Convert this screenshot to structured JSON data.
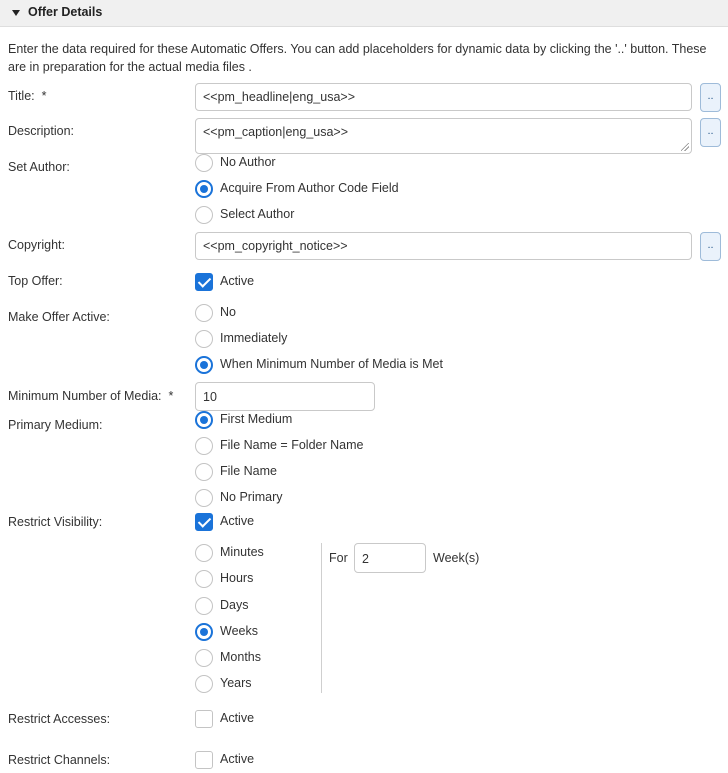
{
  "section": {
    "title": "Offer Details"
  },
  "intro": "Enter the data required for these Automatic Offers. You can add placeholders for dynamic data by clicking the '..' button. These are in preparation for the actual media files .",
  "dots_label": "..",
  "title_field": {
    "label": "Title:",
    "required": "*",
    "value": "<<pm_headline|eng_usa>>"
  },
  "description_field": {
    "label": "Description:",
    "value": "<<pm_caption|eng_usa>>"
  },
  "set_author": {
    "label": "Set Author:",
    "options": [
      "No Author",
      "Acquire From Author Code Field",
      "Select Author"
    ],
    "selected": "Acquire From Author Code Field"
  },
  "copyright_field": {
    "label": "Copyright:",
    "value": "<<pm_copyright_notice>>"
  },
  "top_offer": {
    "label": "Top Offer:",
    "checkbox_label": "Active",
    "checked": true
  },
  "make_offer_active": {
    "label": "Make Offer Active:",
    "options": [
      "No",
      "Immediately",
      "When Minimum Number of Media is Met"
    ],
    "selected": "When Minimum Number of Media is Met"
  },
  "min_media": {
    "label": "Minimum Number of Media:",
    "required": "*",
    "value": "10"
  },
  "primary_medium": {
    "label": "Primary Medium:",
    "options": [
      "First Medium",
      "File Name = Folder Name",
      "File Name",
      "No Primary"
    ],
    "selected": "First Medium"
  },
  "restrict_visibility": {
    "label": "Restrict Visibility:",
    "checkbox_label": "Active",
    "checked": true,
    "units": [
      "Minutes",
      "Hours",
      "Days",
      "Weeks",
      "Months",
      "Years"
    ],
    "selected_unit": "Weeks",
    "for_label": "For",
    "for_value": "2",
    "unit_suffix": "Week(s)"
  },
  "restrict_accesses": {
    "label": "Restrict Accesses:",
    "checkbox_label": "Active",
    "checked": false
  },
  "restrict_channels": {
    "label": "Restrict Channels:",
    "checkbox_label": "Active",
    "checked": false
  },
  "colors": {
    "accent": "#1a73d9",
    "header_bg": "#f0f0f0",
    "text": "#333333"
  }
}
